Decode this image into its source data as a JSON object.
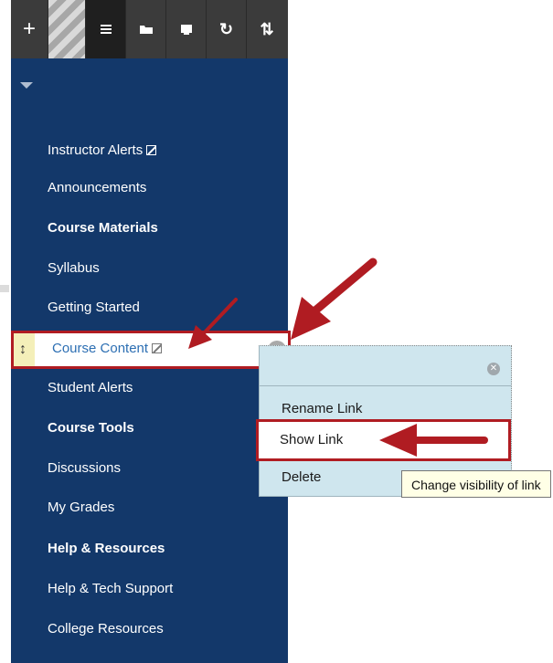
{
  "toolbar": {
    "buttons": [
      {
        "name": "add",
        "glyph": "+"
      },
      {
        "name": "separator",
        "glyph": ""
      },
      {
        "name": "list",
        "glyph": "≡"
      },
      {
        "name": "folder",
        "glyph": ""
      },
      {
        "name": "window",
        "glyph": ""
      },
      {
        "name": "refresh",
        "glyph": "↻"
      },
      {
        "name": "sort",
        "glyph": "⇅"
      }
    ]
  },
  "sidebar": {
    "items": [
      {
        "label": "Instructor Alerts",
        "bold": false,
        "hidden": true
      },
      {
        "label": "Announcements",
        "bold": false,
        "hidden": false
      },
      {
        "label": "Course Materials",
        "bold": true,
        "hidden": false
      },
      {
        "label": "Syllabus",
        "bold": false,
        "hidden": false
      },
      {
        "label": "Getting Started",
        "bold": false,
        "hidden": false
      },
      {
        "label": "Course Content",
        "bold": false,
        "hidden": true,
        "selected": true
      },
      {
        "label": "Student Alerts",
        "bold": false,
        "hidden": false
      },
      {
        "label": "Course Tools",
        "bold": true,
        "hidden": false
      },
      {
        "label": "Discussions",
        "bold": false,
        "hidden": false
      },
      {
        "label": "My Grades",
        "bold": false,
        "hidden": false
      },
      {
        "label": "Help & Resources",
        "bold": true,
        "hidden": false
      },
      {
        "label": "Help & Tech Support",
        "bold": false,
        "hidden": false
      },
      {
        "label": "College Resources",
        "bold": false,
        "hidden": false
      }
    ]
  },
  "context_menu": {
    "items": [
      "Rename Link",
      "Show Link",
      "Delete"
    ],
    "tooltip": "Change visibility of link"
  },
  "colors": {
    "sidebar_bg": "#13386a",
    "toolbar_bg": "#3b3b3b",
    "menu_bg": "#cfe6ee",
    "highlight_red": "#b01c22",
    "link_blue": "#2d6fb3"
  }
}
